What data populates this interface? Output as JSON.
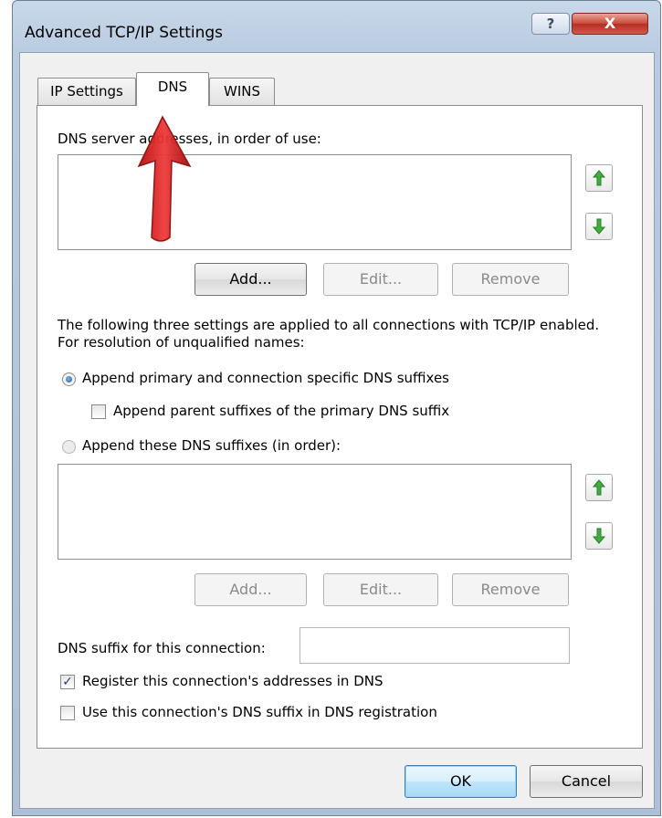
{
  "window": {
    "title": "Advanced TCP/IP Settings",
    "help_label": "?",
    "close_label": "X"
  },
  "tabs": [
    {
      "label": "IP Settings",
      "active": false
    },
    {
      "label": "DNS",
      "active": true
    },
    {
      "label": "WINS",
      "active": false
    }
  ],
  "dns_servers": {
    "label": "DNS server addresses, in order of use:",
    "entries": [],
    "add_label": "Add...",
    "edit_label": "Edit...",
    "remove_label": "Remove"
  },
  "resolution": {
    "description": "The following three settings are applied to all connections with TCP/IP enabled. For resolution of unqualified names:",
    "option_primary_label": "Append primary and connection specific DNS suffixes",
    "option_primary_selected": true,
    "parent_suffix_label": "Append parent suffixes of the primary DNS suffix",
    "parent_suffix_checked": false,
    "option_these_label": "Append these DNS suffixes (in order):",
    "option_these_selected": false
  },
  "suffixes": {
    "entries": [],
    "add_label": "Add...",
    "edit_label": "Edit...",
    "remove_label": "Remove"
  },
  "connection_suffix": {
    "label": "DNS suffix for this connection:",
    "value": ""
  },
  "register": {
    "label": "Register this connection's addresses in DNS",
    "checked": true
  },
  "use_suffix": {
    "label": "Use this connection's DNS suffix in DNS registration",
    "checked": false
  },
  "footer": {
    "ok_label": "OK",
    "cancel_label": "Cancel"
  },
  "colors": {
    "annotation_arrow": "#e01e1e",
    "move_arrow": "#3fae3f"
  }
}
